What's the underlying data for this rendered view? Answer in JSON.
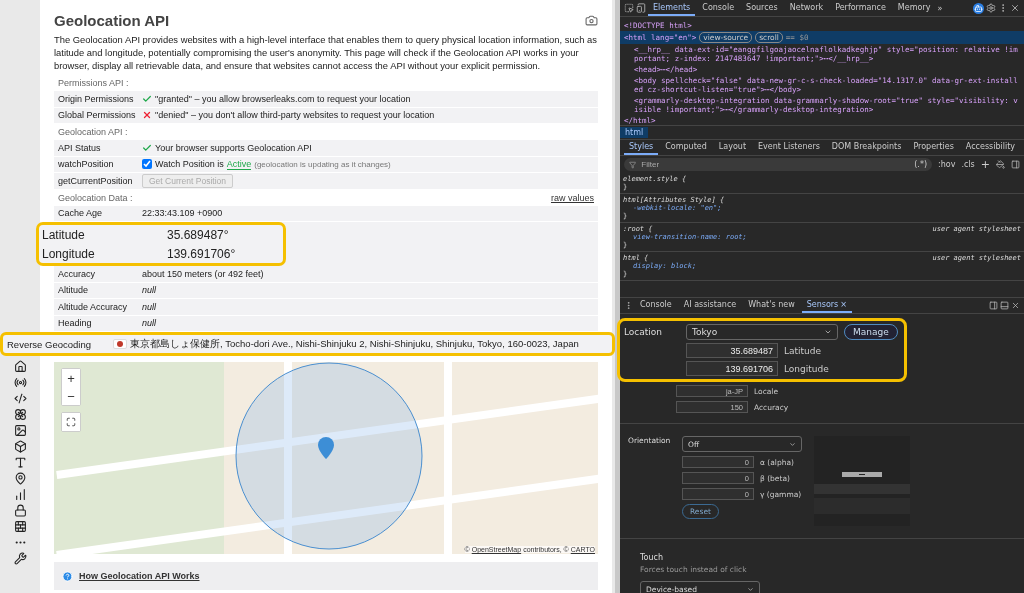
{
  "page": {
    "title": "Geolocation API",
    "description": "The Geolocation API provides websites with a high-level interface that enables them to query physical location information, such as latitude and longitude, potentially compromising the user's anonymity. This page will check if the Geolocation API works in your browser, display all retrievable data, and ensure that websites cannot access the API without your explicit permission.",
    "permissions": {
      "heading": "Permissions API :",
      "rows": [
        {
          "label": "Origin Permissions",
          "passed": true,
          "value": "\"granted\" – you allow browserleaks.com to request your location"
        },
        {
          "label": "Global Permissions",
          "passed": false,
          "value": "\"denied\" – you don't allow third-party websites to request your location"
        }
      ]
    },
    "api": {
      "heading": "Geolocation API :",
      "status": {
        "label": "API Status",
        "passed": true,
        "value": "Your browser supports Geolocation API"
      },
      "watch": {
        "label": "watchPosition",
        "checked": true,
        "text": "Watch Position is",
        "state": "Active",
        "note": "(geolocation is updating as it changes)"
      },
      "current": {
        "label": "getCurrentPosition",
        "button": "Get Current Position",
        "disabled": true
      }
    },
    "data": {
      "heading": "Geolocation Data :",
      "raw_link": "raw values",
      "cache": {
        "label": "Cache Age",
        "value": "22:33:43.109 +0900"
      },
      "highlight": [
        {
          "label": "Latitude",
          "value": "35.689487°"
        },
        {
          "label": "Longitude",
          "value": "139.691706°"
        }
      ],
      "rows": [
        {
          "label": "Accuracy",
          "value": "about 150 meters (or 492 feet)",
          "kind": "text"
        },
        {
          "label": "Altitude",
          "value": "null",
          "kind": "empty"
        },
        {
          "label": "Altitude Accuracy",
          "value": "null",
          "kind": "empty"
        },
        {
          "label": "Heading",
          "value": "null",
          "kind": "empty"
        }
      ]
    },
    "geocoding": {
      "label": "Reverse Geocoding",
      "address": "東京都島しょ保健所, Tocho-dori Ave., Nishi-Shinjuku 2, Nishi-Shinjuku, Shinjuku, Tokyo, 160-0023, Japan"
    },
    "map": {
      "zoom_in": "+",
      "zoom_out": "−",
      "attribution": {
        "prefix": "©",
        "link_1": "OpenStreetMap",
        "middle": "contributors, ©",
        "link_2": "CARTO"
      }
    },
    "help_link": "How Geolocation API Works"
  },
  "devtools": {
    "tabs": [
      {
        "label": "Elements",
        "selected": true
      },
      {
        "label": "Console",
        "selected": false
      },
      {
        "label": "Sources",
        "selected": false
      },
      {
        "label": "Network",
        "selected": false
      },
      {
        "label": "Performance",
        "selected": false
      },
      {
        "label": "Memory",
        "selected": false
      }
    ],
    "more": "»",
    "dom": [
      {
        "text": "<!DOCTYPE html>",
        "selected": false
      },
      {
        "text": "<html lang=\"en\">",
        "selected": true,
        "badges": [
          "view-source",
          "scroll"
        ],
        "suffix": "== $0",
        "children": [
          {
            "text": "<__hrp__ data-ext-id=\"eanggfilgoajaocelnaflolkadkeghjp\" style=\"position: relative !important; z-index: 2147483647 !important;\">⋯</__hrp__>",
            "selected": false
          },
          {
            "text": "<head>⋯</head>",
            "selected": false
          },
          {
            "text": "<body spellcheck=\"false\" data-new-gr-c-s-check-loaded=\"14.1317.0\" data-gr-ext-installed cz-shortcut-listen=\"true\">⋯</body>",
            "selected": false
          },
          {
            "text": "<grammarly-desktop-integration data-grammarly-shadow-root=\"true\" style=\"visibility: visible !important;\">⋯</grammarly-desktop-integration>",
            "selected": false
          }
        ]
      },
      {
        "text": "</html>",
        "selected": false
      }
    ],
    "breadcrumb": "html",
    "style_tabs": [
      {
        "label": "Styles",
        "selected": true
      },
      {
        "label": "Computed",
        "selected": false
      },
      {
        "label": "Layout",
        "selected": false
      },
      {
        "label": "Event Listeners",
        "selected": false
      },
      {
        "label": "DOM Breakpoints",
        "selected": false
      },
      {
        "label": "Properties",
        "selected": false
      },
      {
        "label": "Accessibility",
        "selected": false
      }
    ],
    "filter": {
      "placeholder": "Filter",
      "regex": "(.*)",
      "hov": ":hov",
      "cls": ".cls",
      "add": "+"
    },
    "rules": [
      {
        "selector": "element.style {",
        "close": "}"
      },
      {
        "selector": "html[Attributes Style] {",
        "declarations": [
          "-webkit-locale: \"en\";"
        ],
        "close": "}"
      },
      {
        "selector": ":root {",
        "source": "user agent stylesheet",
        "declarations": [
          "view-transition-name: root;"
        ],
        "close": "}"
      },
      {
        "selector": "html {",
        "source": "user agent stylesheet",
        "declarations": [
          "display: block;"
        ],
        "close": "}"
      }
    ],
    "drawer_tabs": [
      {
        "label": "Console",
        "selected": false
      },
      {
        "label": "AI assistance",
        "selected": false
      },
      {
        "label": "What's new",
        "selected": false
      },
      {
        "label": "Sensors",
        "selected": true,
        "close": "×"
      }
    ],
    "sensors": {
      "location": {
        "label": "Location",
        "value": "Tokyo",
        "manage": "Manage",
        "fields": [
          {
            "value": "35.689487",
            "label": "Latitude"
          },
          {
            "value": "139.691706",
            "label": "Longitude"
          }
        ]
      },
      "extra_fields": [
        {
          "value": "ja-JP",
          "label": "Locale"
        },
        {
          "value": "150",
          "label": "Accuracy"
        }
      ],
      "orientation": {
        "label": "Orientation",
        "value": "Off",
        "fields": [
          {
            "value": "0",
            "label": "α (alpha)"
          },
          {
            "value": "0",
            "label": "β (beta)"
          },
          {
            "value": "0",
            "label": "γ (gamma)"
          }
        ],
        "reset": "Reset"
      },
      "touch": {
        "title": "Touch",
        "hint": "Forces touch instead of click",
        "value": "Device-based"
      }
    }
  }
}
